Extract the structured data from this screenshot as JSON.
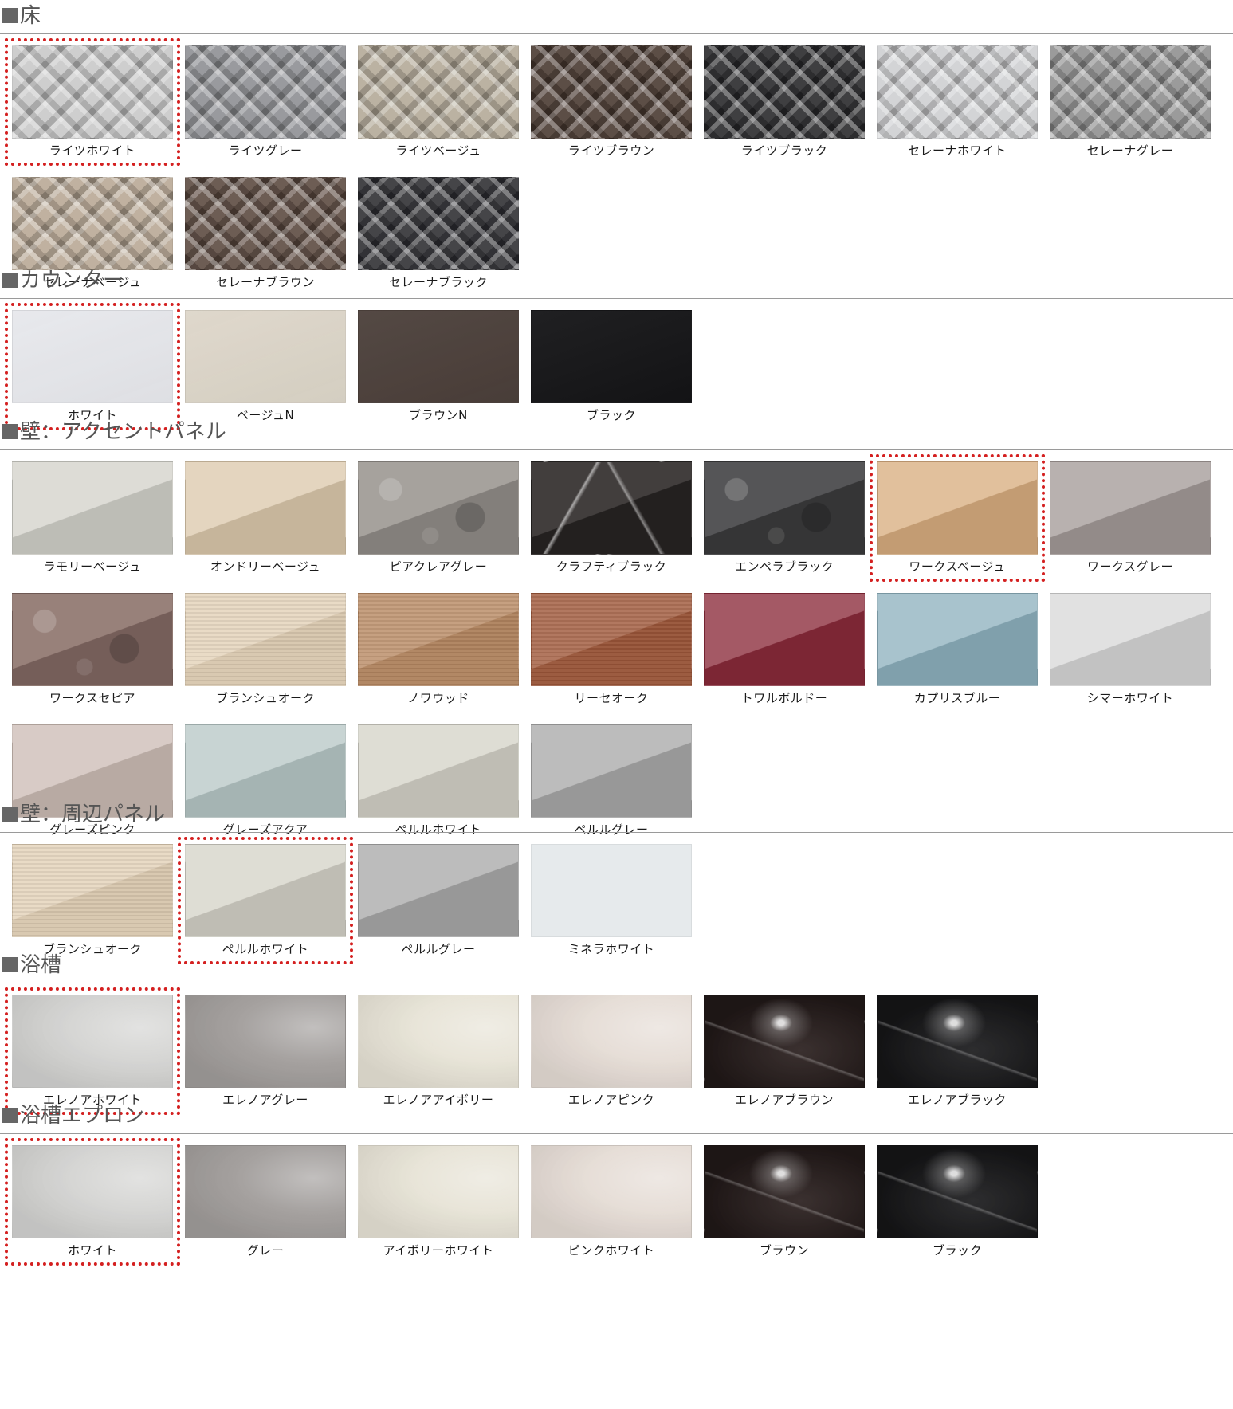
{
  "sections": [
    {
      "id": "floor",
      "title": "床",
      "swatches": [
        {
          "label": "ライツホワイト",
          "color": "#c8c8c8",
          "texture": "weave",
          "selected": true
        },
        {
          "label": "ライツグレー",
          "color": "#8e8f93",
          "texture": "weave",
          "selected": false
        },
        {
          "label": "ライツベージュ",
          "color": "#b3aa98",
          "texture": "weave",
          "selected": false
        },
        {
          "label": "ライツブラウン",
          "color": "#4a3a32",
          "texture": "weave",
          "selected": false
        },
        {
          "label": "ライツブラック",
          "color": "#2a2a2c",
          "texture": "weave",
          "selected": false
        },
        {
          "label": "セレーナホワイト",
          "color": "#cfd0d2",
          "texture": "weave",
          "selected": false
        },
        {
          "label": "セレーナグレー",
          "color": "#909090",
          "texture": "weave",
          "selected": false
        },
        {
          "label": "セレーナベージュ",
          "color": "#b9a996",
          "texture": "weave",
          "selected": false
        },
        {
          "label": "セレーナブラウン",
          "color": "#5d4b41",
          "texture": "weave",
          "selected": false
        },
        {
          "label": "セレーナブラック",
          "color": "#303034",
          "texture": "weave",
          "selected": false
        }
      ]
    },
    {
      "id": "counter",
      "title": "カウンター",
      "swatches": [
        {
          "label": "ホワイト",
          "color": "#e7e8ec",
          "texture": "matte",
          "selected": true
        },
        {
          "label": "ベージュN",
          "color": "#ddd6c9",
          "texture": "matte",
          "selected": false
        },
        {
          "label": "ブラウンN",
          "color": "#4b3f3a",
          "texture": "matte",
          "selected": false
        },
        {
          "label": "ブラック",
          "color": "#141416",
          "texture": "matte",
          "selected": false
        }
      ]
    },
    {
      "id": "wall-accent",
      "title": "壁：アクセントパネル",
      "swatches": [
        {
          "label": "ラモリーベージュ",
          "color": "#d3d2cb",
          "texture": "diag",
          "selected": false
        },
        {
          "label": "オンドリーベージュ",
          "color": "#dcc9ad",
          "texture": "diag",
          "selected": false
        },
        {
          "label": "ピアクレアグレー",
          "color": "#9a9590",
          "texture": "stone",
          "selected": false
        },
        {
          "label": "クラフティブラック",
          "color": "#2c2827",
          "texture": "marble",
          "selected": false
        },
        {
          "label": "エンペラブラック",
          "color": "#3e3e40",
          "texture": "stone",
          "selected": false
        },
        {
          "label": "ワークスベージュ",
          "color": "#d9ae80",
          "texture": "diag",
          "selected": true
        },
        {
          "label": "ワークスグレー",
          "color": "#a49b99",
          "texture": "diag",
          "selected": false
        },
        {
          "label": "ワークスセピア",
          "color": "#8a6f68",
          "texture": "stone",
          "selected": false
        },
        {
          "label": "ブランシュオーク",
          "color": "#e4d2b8",
          "texture": "wood",
          "selected": false
        },
        {
          "label": "ノワウッド",
          "color": "#b98a63",
          "texture": "wood",
          "selected": false
        },
        {
          "label": "リーセオーク",
          "color": "#a0583a",
          "texture": "wood",
          "selected": false
        },
        {
          "label": "トワルボルドー",
          "color": "#8a2a3a",
          "texture": "diag",
          "selected": false
        },
        {
          "label": "カプリスブルー",
          "color": "#8fb2bf",
          "texture": "diag",
          "selected": false
        },
        {
          "label": "シマーホワイト",
          "color": "#d8d8d8",
          "texture": "diag",
          "selected": false
        },
        {
          "label": "グレーズピンク",
          "color": "#cdbdb6",
          "texture": "diag",
          "selected": false
        },
        {
          "label": "グレーズアクア",
          "color": "#b8c8c7",
          "texture": "diag",
          "selected": false
        },
        {
          "label": "ペルルホワイト",
          "color": "#d5d3c8",
          "texture": "diag",
          "selected": false
        },
        {
          "label": "ペルルグレー",
          "color": "#a9a9a9",
          "texture": "diag",
          "selected": false
        }
      ]
    },
    {
      "id": "wall-surround",
      "title": "壁：周辺パネル",
      "swatches": [
        {
          "label": "ブランシュオーク",
          "color": "#e4d2b8",
          "texture": "wood",
          "selected": false
        },
        {
          "label": "ペルルホワイト",
          "color": "#d5d3c8",
          "texture": "diag",
          "selected": true
        },
        {
          "label": "ペルルグレー",
          "color": "#a9a9a9",
          "texture": "diag",
          "selected": false
        },
        {
          "label": "ミネラホワイト",
          "color": "#e6eaec",
          "texture": "plain",
          "selected": false
        }
      ]
    },
    {
      "id": "bathtub",
      "title": "浴槽",
      "swatches": [
        {
          "label": "エレノアホワイト",
          "color": "#d3d3d1",
          "texture": "tub",
          "selected": true
        },
        {
          "label": "エレノアグレー",
          "color": "#a19d9b",
          "texture": "tub",
          "selected": false
        },
        {
          "label": "エレノアアイボリー",
          "color": "#e7e3d6",
          "texture": "tub",
          "selected": false
        },
        {
          "label": "エレノアピンク",
          "color": "#e5dcd5",
          "texture": "tub",
          "selected": false
        },
        {
          "label": "エレノアブラウン",
          "color": "#2a1f1e",
          "texture": "tubdark",
          "selected": false
        },
        {
          "label": "エレノアブラック",
          "color": "#1b1b1d",
          "texture": "tubdark",
          "selected": false
        }
      ]
    },
    {
      "id": "apron",
      "title": "浴槽エプロン",
      "swatches": [
        {
          "label": "ホワイト",
          "color": "#d3d3d1",
          "texture": "tub",
          "selected": true
        },
        {
          "label": "グレー",
          "color": "#a19d9b",
          "texture": "tub",
          "selected": false
        },
        {
          "label": "アイボリーホワイト",
          "color": "#e7e3d6",
          "texture": "tub",
          "selected": false
        },
        {
          "label": "ピンクホワイト",
          "color": "#e5dcd5",
          "texture": "tub",
          "selected": false
        },
        {
          "label": "ブラウン",
          "color": "#2a1f1e",
          "texture": "tubdark",
          "selected": false
        },
        {
          "label": "ブラック",
          "color": "#1b1b1d",
          "texture": "tubdark",
          "selected": false
        }
      ]
    }
  ],
  "colors": {
    "selection_border": "#d42020",
    "section_rule": "#9a9a9a",
    "section_square": "#666666"
  }
}
